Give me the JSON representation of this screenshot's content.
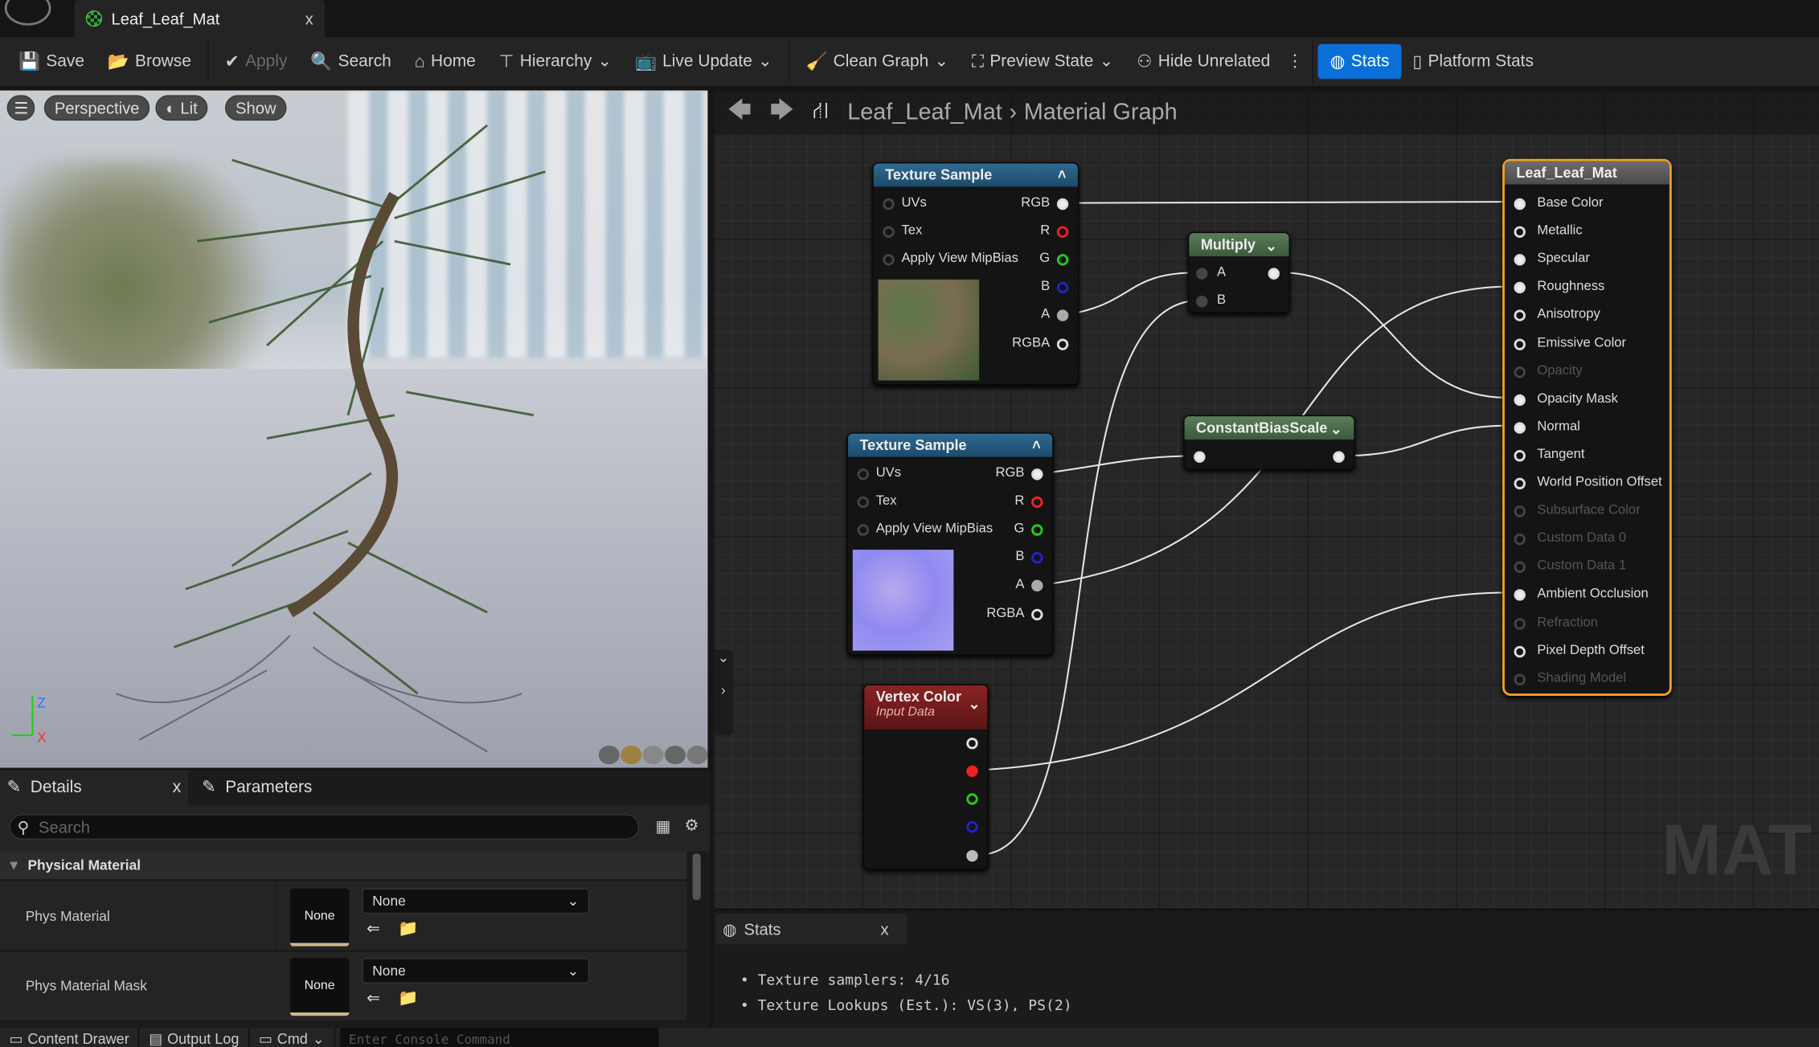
{
  "tab": {
    "title": "Leaf_Leaf_Mat",
    "close": "x"
  },
  "toolbar": {
    "save": "Save",
    "browse": "Browse",
    "apply": "Apply",
    "search": "Search",
    "home": "Home",
    "hierarchy": "Hierarchy",
    "live_update": "Live Update",
    "clean_graph": "Clean Graph",
    "preview_state": "Preview State",
    "hide_unrelated": "Hide Unrelated",
    "stats": "Stats",
    "platform_stats": "Platform Stats",
    "accent": "#0a70d8"
  },
  "viewport": {
    "perspective": "Perspective",
    "lit": "Lit",
    "show": "Show",
    "axis_z": "Z",
    "axis_x": "X"
  },
  "breadcrumb": {
    "asset": "Leaf_Leaf_Mat",
    "graph": "Material Graph"
  },
  "nodes": {
    "tex1": {
      "title": "Texture Sample",
      "inputs": [
        "UVs",
        "Tex",
        "Apply View MipBias"
      ],
      "outputs": [
        "RGB",
        "R",
        "G",
        "B",
        "A",
        "RGBA"
      ]
    },
    "tex2": {
      "title": "Texture Sample",
      "inputs": [
        "UVs",
        "Tex",
        "Apply View MipBias"
      ],
      "outputs": [
        "RGB",
        "R",
        "G",
        "B",
        "A",
        "RGBA"
      ]
    },
    "multiply": {
      "title": "Multiply",
      "inputs": [
        "A",
        "B"
      ]
    },
    "cbs": {
      "title": "ConstantBiasScale"
    },
    "vertex": {
      "title": "Vertex Color",
      "subtitle": "Input Data"
    },
    "result": {
      "title": "Leaf_Leaf_Mat",
      "pins": [
        {
          "label": "Base Color",
          "on": true
        },
        {
          "label": "Metallic",
          "on": true
        },
        {
          "label": "Specular",
          "on": true
        },
        {
          "label": "Roughness",
          "on": true
        },
        {
          "label": "Anisotropy",
          "on": true
        },
        {
          "label": "Emissive Color",
          "on": true
        },
        {
          "label": "Opacity",
          "on": false
        },
        {
          "label": "Opacity Mask",
          "on": true
        },
        {
          "label": "Normal",
          "on": true
        },
        {
          "label": "Tangent",
          "on": true
        },
        {
          "label": "World Position Offset",
          "on": true
        },
        {
          "label": "Subsurface Color",
          "on": false
        },
        {
          "label": "Custom Data 0",
          "on": false
        },
        {
          "label": "Custom Data 1",
          "on": false
        },
        {
          "label": "Ambient Occlusion",
          "on": true
        },
        {
          "label": "Refraction",
          "on": false
        },
        {
          "label": "Pixel Depth Offset",
          "on": true
        },
        {
          "label": "Shading Model",
          "on": false
        }
      ]
    }
  },
  "watermark": "MAT",
  "stats": {
    "tab": "Stats",
    "close": "x",
    "lines": [
      "Texture samplers: 4/16",
      "Texture Lookups (Est.): VS(3), PS(2)"
    ]
  },
  "details": {
    "tab": "Details",
    "close": "x",
    "params_tab": "Parameters",
    "search_placeholder": "Search",
    "category": "Physical Material",
    "rows": [
      {
        "label": "Phys Material",
        "thumb": "None",
        "value": "None"
      },
      {
        "label": "Phys Material Mask",
        "thumb": "None",
        "value": "None"
      }
    ]
  },
  "bottombar": {
    "content_drawer": "Content Drawer",
    "output_log": "Output Log",
    "cmd": "Cmd",
    "console_placeholder": "Enter Console Command"
  }
}
